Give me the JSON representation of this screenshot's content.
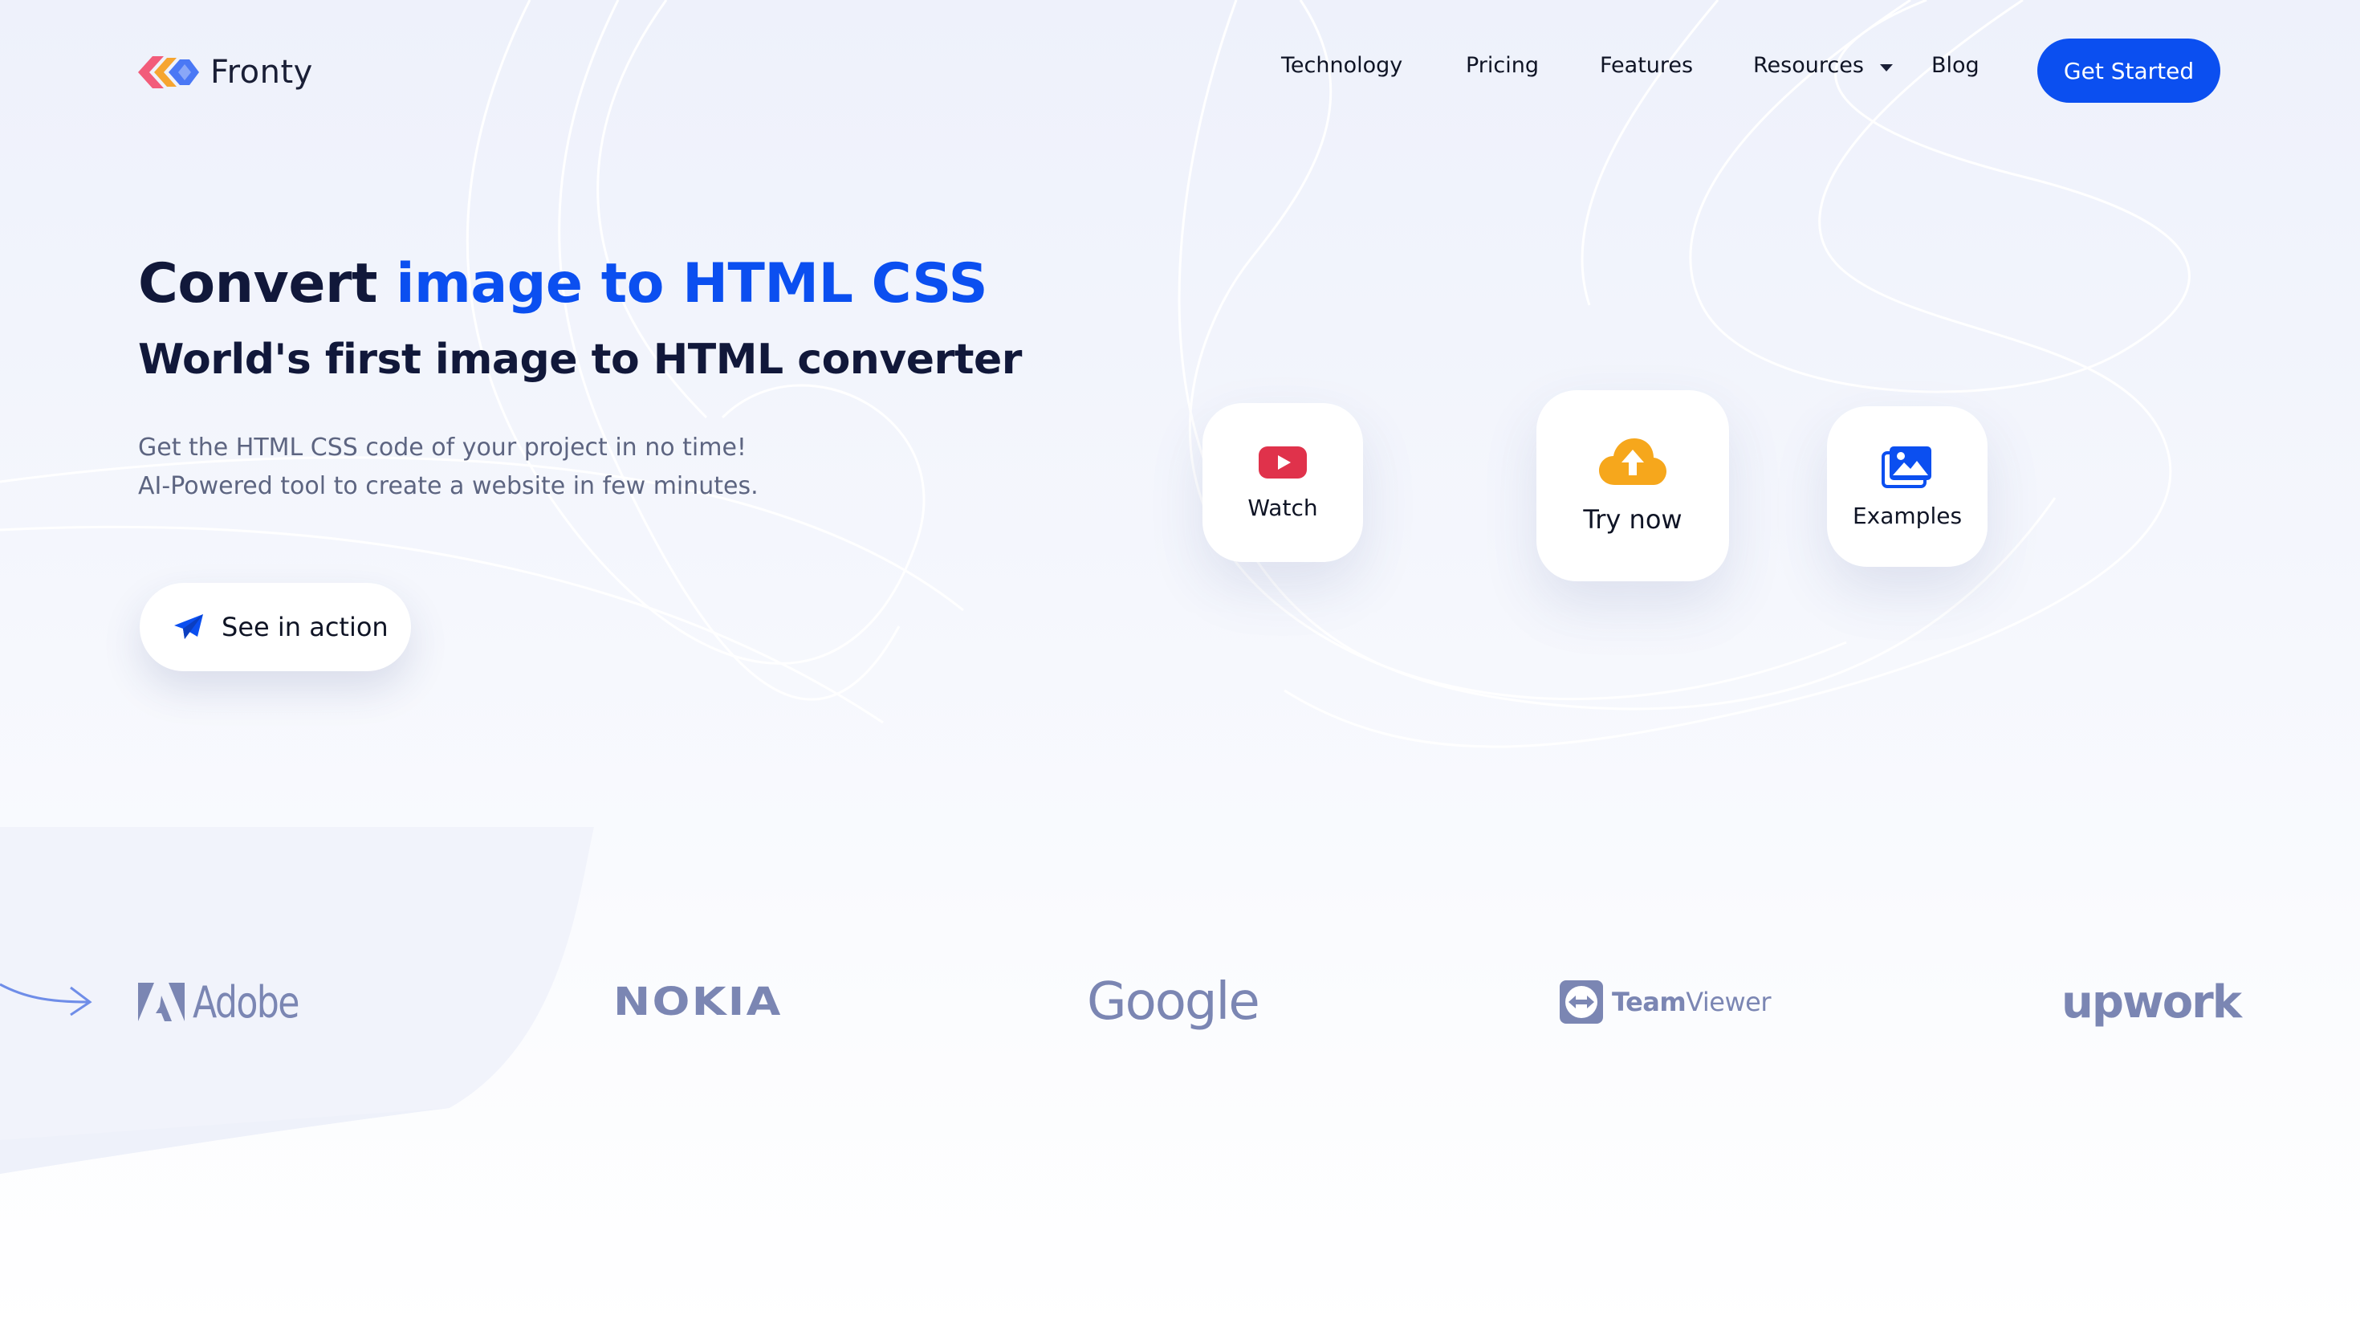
{
  "brand": {
    "name": "Fronty",
    "accent_color": "#0b4ff0",
    "logo_colors": [
      "#f25c7a",
      "#f6a530",
      "#4a78f5"
    ]
  },
  "nav": {
    "items": [
      {
        "label": "Technology"
      },
      {
        "label": "Pricing"
      },
      {
        "label": "Features"
      },
      {
        "label": "Resources",
        "has_dropdown": true
      },
      {
        "label": "Blog"
      }
    ],
    "cta_label": "Get Started"
  },
  "hero": {
    "title_prefix": "Convert ",
    "title_highlight": "image to HTML CSS",
    "subtitle": "World's first image to HTML converter",
    "description_lines": [
      "Get the HTML CSS code of your project in no time!",
      "AI-Powered tool to create a website in few minutes."
    ],
    "action_label": "See in action",
    "action_icon": "paper-plane-icon"
  },
  "actions": [
    {
      "label": "Watch",
      "icon": "youtube-icon",
      "icon_color": "#e0324b"
    },
    {
      "label": "Try now",
      "icon": "cloud-upload-icon",
      "icon_color": "#f6a71c"
    },
    {
      "label": "Examples",
      "icon": "image-gallery-icon",
      "icon_color": "#0b4ff0"
    }
  ],
  "clients": [
    {
      "name": "Adobe"
    },
    {
      "name": "NOKIA"
    },
    {
      "name": "Google"
    },
    {
      "name_bold": "Team",
      "name_light": "Viewer"
    },
    {
      "name": "upwork"
    }
  ],
  "colors": {
    "heading": "#11183a",
    "muted": "#5d6581",
    "client_logo": "#7b86b3"
  }
}
